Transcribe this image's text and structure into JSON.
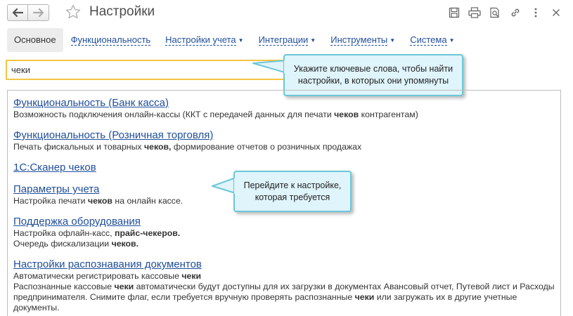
{
  "window": {
    "title": "Настройки"
  },
  "nav": {
    "back_icon": "arrow-left-icon",
    "forward_icon": "arrow-right-icon"
  },
  "toolbar_icons": [
    "save-icon",
    "print-icon",
    "preview-icon",
    "link-icon",
    "more-icon",
    "close-icon"
  ],
  "tabs": [
    {
      "label": "Основное",
      "active": true,
      "dropdown": false
    },
    {
      "label": "Функциональность",
      "active": false,
      "dropdown": false
    },
    {
      "label": "Настройки учета",
      "active": false,
      "dropdown": true
    },
    {
      "label": "Интеграции",
      "active": false,
      "dropdown": true
    },
    {
      "label": "Инструменты",
      "active": false,
      "dropdown": true
    },
    {
      "label": "Система",
      "active": false,
      "dropdown": true
    }
  ],
  "search": {
    "value": "чеки"
  },
  "callouts": {
    "keywords": "Укажите ключевые слова, чтобы найти настройки, в которых они упомянуты",
    "navigate": "Перейдите к настройке, которая требуется"
  },
  "results": [
    {
      "title": "Функциональность (Банк касса)",
      "lines": [
        [
          {
            "t": "Возможность подключения онлайн-кассы (ККТ с передачей данных для печати "
          },
          {
            "t": "чеков",
            "b": true
          },
          {
            "t": " контрагентам)"
          }
        ]
      ]
    },
    {
      "title": "Функциональность (Розничная торговля)",
      "lines": [
        [
          {
            "t": "Печать фискальных и товарных "
          },
          {
            "t": "чеков,",
            "b": true
          },
          {
            "t": " формирование отчетов о розничных продажах"
          }
        ]
      ]
    },
    {
      "title": "1С:Сканер чеков",
      "lines": []
    },
    {
      "title": "Параметры учета",
      "lines": [
        [
          {
            "t": "Настройка печати "
          },
          {
            "t": "чеков",
            "b": true
          },
          {
            "t": " на онлайн кассе."
          }
        ]
      ]
    },
    {
      "title": "Поддержка оборудования",
      "lines": [
        [
          {
            "t": "Настройка офлайн-касс, "
          },
          {
            "t": "прайс-чекеров.",
            "b": true
          }
        ],
        [
          {
            "t": "Очередь фискализации "
          },
          {
            "t": "чеков.",
            "b": true
          }
        ]
      ]
    },
    {
      "title": "Настройки распознавания документов",
      "lines": [
        [
          {
            "t": "Автоматически регистрировать кассовые "
          },
          {
            "t": "чеки",
            "b": true
          }
        ],
        [
          {
            "t": "Распознанные кассовые "
          },
          {
            "t": "чеки",
            "b": true
          },
          {
            "t": " автоматически будут доступны для их загрузки в документах Авансовый отчет, Путевой лист и Расходы предпринимателя. Снимите флаг, если требуется вручную проверять распознанные "
          },
          {
            "t": "чеки",
            "b": true
          },
          {
            "t": " или загружать их в другие учетные документы."
          }
        ]
      ]
    }
  ]
}
